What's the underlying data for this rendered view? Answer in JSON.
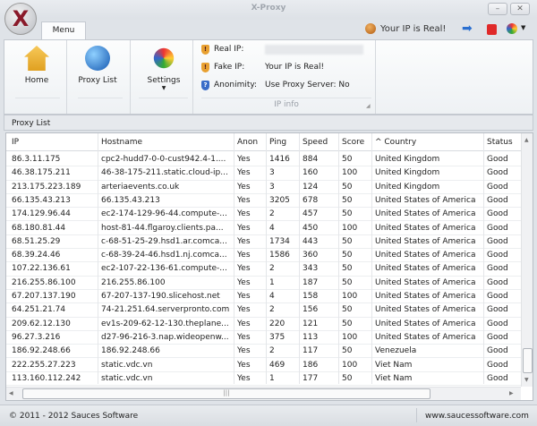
{
  "window": {
    "title": "X-Proxy",
    "logo_text": "X"
  },
  "tabs": [
    {
      "label": "Menu"
    }
  ],
  "status_top": {
    "text": "Your IP is Real!"
  },
  "ribbon": {
    "buttons": [
      {
        "label": "Home",
        "icon": "home-icon"
      },
      {
        "label": "Proxy List",
        "icon": "globe-icon"
      },
      {
        "label": "Settings",
        "icon": "tools-icon"
      }
    ],
    "ip_info": {
      "group_label": "IP info",
      "real_ip_label": "Real IP:",
      "real_ip_value": "",
      "fake_ip_label": "Fake IP:",
      "fake_ip_value": "Your IP is Real!",
      "anon_label": "Anonimity:",
      "anon_value": "Use Proxy Server: No"
    }
  },
  "panel": {
    "title": "Proxy List"
  },
  "table": {
    "columns": [
      "IP",
      "Hostname",
      "Anon",
      "Ping",
      "Speed",
      "Score",
      "^ Country",
      "Status"
    ],
    "rows": [
      [
        "86.3.11.175",
        "cpc2-hudd7-0-0-cust942.4-1....",
        "Yes",
        "1416",
        "884",
        "50",
        "United Kingdom",
        "Good"
      ],
      [
        "46.38.175.211",
        "46-38-175-211.static.cloud-ip...",
        "Yes",
        "3",
        "160",
        "100",
        "United Kingdom",
        "Good"
      ],
      [
        "213.175.223.189",
        "arteriaevents.co.uk",
        "Yes",
        "3",
        "124",
        "50",
        "United Kingdom",
        "Good"
      ],
      [
        "66.135.43.213",
        "66.135.43.213",
        "Yes",
        "3205",
        "678",
        "50",
        "United States of America",
        "Good"
      ],
      [
        "174.129.96.44",
        "ec2-174-129-96-44.compute-...",
        "Yes",
        "2",
        "457",
        "50",
        "United States of America",
        "Good"
      ],
      [
        "68.180.81.44",
        "host-81-44.flgaroy.clients.pa...",
        "Yes",
        "4",
        "450",
        "100",
        "United States of America",
        "Good"
      ],
      [
        "68.51.25.29",
        "c-68-51-25-29.hsd1.ar.comca...",
        "Yes",
        "1734",
        "443",
        "50",
        "United States of America",
        "Good"
      ],
      [
        "68.39.24.46",
        "c-68-39-24-46.hsd1.nj.comca...",
        "Yes",
        "1586",
        "360",
        "50",
        "United States of America",
        "Good"
      ],
      [
        "107.22.136.61",
        "ec2-107-22-136-61.compute-...",
        "Yes",
        "2",
        "343",
        "50",
        "United States of America",
        "Good"
      ],
      [
        "216.255.86.100",
        "216.255.86.100",
        "Yes",
        "1",
        "187",
        "50",
        "United States of America",
        "Good"
      ],
      [
        "67.207.137.190",
        "67-207-137-190.slicehost.net",
        "Yes",
        "4",
        "158",
        "100",
        "United States of America",
        "Good"
      ],
      [
        "64.251.21.74",
        "74-21.251.64.serverpronto.com",
        "Yes",
        "2",
        "156",
        "50",
        "United States of America",
        "Good"
      ],
      [
        "209.62.12.130",
        "ev1s-209-62-12-130.theplane...",
        "Yes",
        "220",
        "121",
        "50",
        "United States of America",
        "Good"
      ],
      [
        "96.27.3.216",
        "d27-96-216-3.nap.wideopenw...",
        "Yes",
        "375",
        "113",
        "100",
        "United States of America",
        "Good"
      ],
      [
        "186.92.248.66",
        "186.92.248.66",
        "Yes",
        "2",
        "117",
        "50",
        "Venezuela",
        "Good"
      ],
      [
        "222.255.27.223",
        "static.vdc.vn",
        "Yes",
        "469",
        "186",
        "100",
        "Viet Nam",
        "Good"
      ],
      [
        "113.160.112.242",
        "static.vdc.vn",
        "Yes",
        "1",
        "177",
        "50",
        "Viet Nam",
        "Good"
      ]
    ]
  },
  "statusbar": {
    "copyright": "© 2011 - 2012 Sauces Software",
    "website": "www.saucessoftware.com"
  }
}
